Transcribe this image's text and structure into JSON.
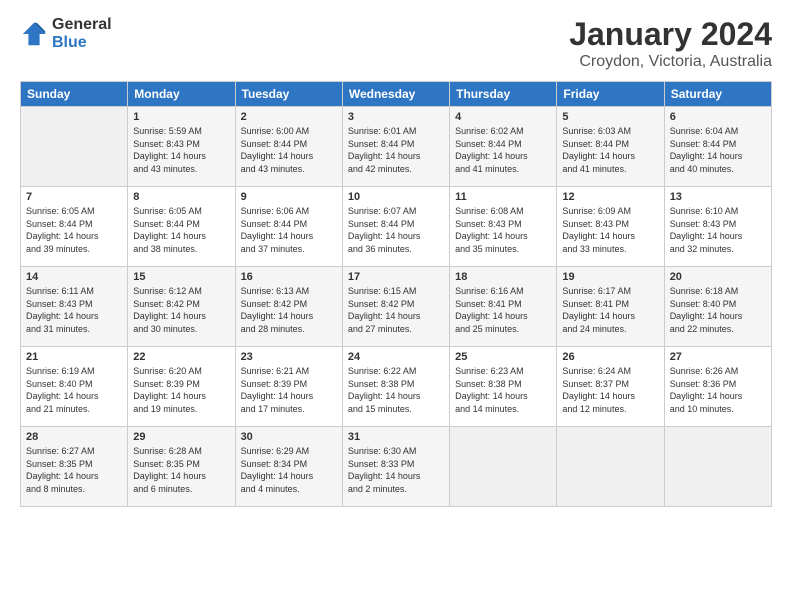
{
  "logo": {
    "line1": "General",
    "line2": "Blue"
  },
  "title": "January 2024",
  "location": "Croydon, Victoria, Australia",
  "days_header": [
    "Sunday",
    "Monday",
    "Tuesday",
    "Wednesday",
    "Thursday",
    "Friday",
    "Saturday"
  ],
  "weeks": [
    [
      {
        "num": "",
        "text": ""
      },
      {
        "num": "1",
        "text": "Sunrise: 5:59 AM\nSunset: 8:43 PM\nDaylight: 14 hours\nand 43 minutes."
      },
      {
        "num": "2",
        "text": "Sunrise: 6:00 AM\nSunset: 8:44 PM\nDaylight: 14 hours\nand 43 minutes."
      },
      {
        "num": "3",
        "text": "Sunrise: 6:01 AM\nSunset: 8:44 PM\nDaylight: 14 hours\nand 42 minutes."
      },
      {
        "num": "4",
        "text": "Sunrise: 6:02 AM\nSunset: 8:44 PM\nDaylight: 14 hours\nand 41 minutes."
      },
      {
        "num": "5",
        "text": "Sunrise: 6:03 AM\nSunset: 8:44 PM\nDaylight: 14 hours\nand 41 minutes."
      },
      {
        "num": "6",
        "text": "Sunrise: 6:04 AM\nSunset: 8:44 PM\nDaylight: 14 hours\nand 40 minutes."
      }
    ],
    [
      {
        "num": "7",
        "text": "Sunrise: 6:05 AM\nSunset: 8:44 PM\nDaylight: 14 hours\nand 39 minutes."
      },
      {
        "num": "8",
        "text": "Sunrise: 6:05 AM\nSunset: 8:44 PM\nDaylight: 14 hours\nand 38 minutes."
      },
      {
        "num": "9",
        "text": "Sunrise: 6:06 AM\nSunset: 8:44 PM\nDaylight: 14 hours\nand 37 minutes."
      },
      {
        "num": "10",
        "text": "Sunrise: 6:07 AM\nSunset: 8:44 PM\nDaylight: 14 hours\nand 36 minutes."
      },
      {
        "num": "11",
        "text": "Sunrise: 6:08 AM\nSunset: 8:43 PM\nDaylight: 14 hours\nand 35 minutes."
      },
      {
        "num": "12",
        "text": "Sunrise: 6:09 AM\nSunset: 8:43 PM\nDaylight: 14 hours\nand 33 minutes."
      },
      {
        "num": "13",
        "text": "Sunrise: 6:10 AM\nSunset: 8:43 PM\nDaylight: 14 hours\nand 32 minutes."
      }
    ],
    [
      {
        "num": "14",
        "text": "Sunrise: 6:11 AM\nSunset: 8:43 PM\nDaylight: 14 hours\nand 31 minutes."
      },
      {
        "num": "15",
        "text": "Sunrise: 6:12 AM\nSunset: 8:42 PM\nDaylight: 14 hours\nand 30 minutes."
      },
      {
        "num": "16",
        "text": "Sunrise: 6:13 AM\nSunset: 8:42 PM\nDaylight: 14 hours\nand 28 minutes."
      },
      {
        "num": "17",
        "text": "Sunrise: 6:15 AM\nSunset: 8:42 PM\nDaylight: 14 hours\nand 27 minutes."
      },
      {
        "num": "18",
        "text": "Sunrise: 6:16 AM\nSunset: 8:41 PM\nDaylight: 14 hours\nand 25 minutes."
      },
      {
        "num": "19",
        "text": "Sunrise: 6:17 AM\nSunset: 8:41 PM\nDaylight: 14 hours\nand 24 minutes."
      },
      {
        "num": "20",
        "text": "Sunrise: 6:18 AM\nSunset: 8:40 PM\nDaylight: 14 hours\nand 22 minutes."
      }
    ],
    [
      {
        "num": "21",
        "text": "Sunrise: 6:19 AM\nSunset: 8:40 PM\nDaylight: 14 hours\nand 21 minutes."
      },
      {
        "num": "22",
        "text": "Sunrise: 6:20 AM\nSunset: 8:39 PM\nDaylight: 14 hours\nand 19 minutes."
      },
      {
        "num": "23",
        "text": "Sunrise: 6:21 AM\nSunset: 8:39 PM\nDaylight: 14 hours\nand 17 minutes."
      },
      {
        "num": "24",
        "text": "Sunrise: 6:22 AM\nSunset: 8:38 PM\nDaylight: 14 hours\nand 15 minutes."
      },
      {
        "num": "25",
        "text": "Sunrise: 6:23 AM\nSunset: 8:38 PM\nDaylight: 14 hours\nand 14 minutes."
      },
      {
        "num": "26",
        "text": "Sunrise: 6:24 AM\nSunset: 8:37 PM\nDaylight: 14 hours\nand 12 minutes."
      },
      {
        "num": "27",
        "text": "Sunrise: 6:26 AM\nSunset: 8:36 PM\nDaylight: 14 hours\nand 10 minutes."
      }
    ],
    [
      {
        "num": "28",
        "text": "Sunrise: 6:27 AM\nSunset: 8:35 PM\nDaylight: 14 hours\nand 8 minutes."
      },
      {
        "num": "29",
        "text": "Sunrise: 6:28 AM\nSunset: 8:35 PM\nDaylight: 14 hours\nand 6 minutes."
      },
      {
        "num": "30",
        "text": "Sunrise: 6:29 AM\nSunset: 8:34 PM\nDaylight: 14 hours\nand 4 minutes."
      },
      {
        "num": "31",
        "text": "Sunrise: 6:30 AM\nSunset: 8:33 PM\nDaylight: 14 hours\nand 2 minutes."
      },
      {
        "num": "",
        "text": ""
      },
      {
        "num": "",
        "text": ""
      },
      {
        "num": "",
        "text": ""
      }
    ]
  ]
}
